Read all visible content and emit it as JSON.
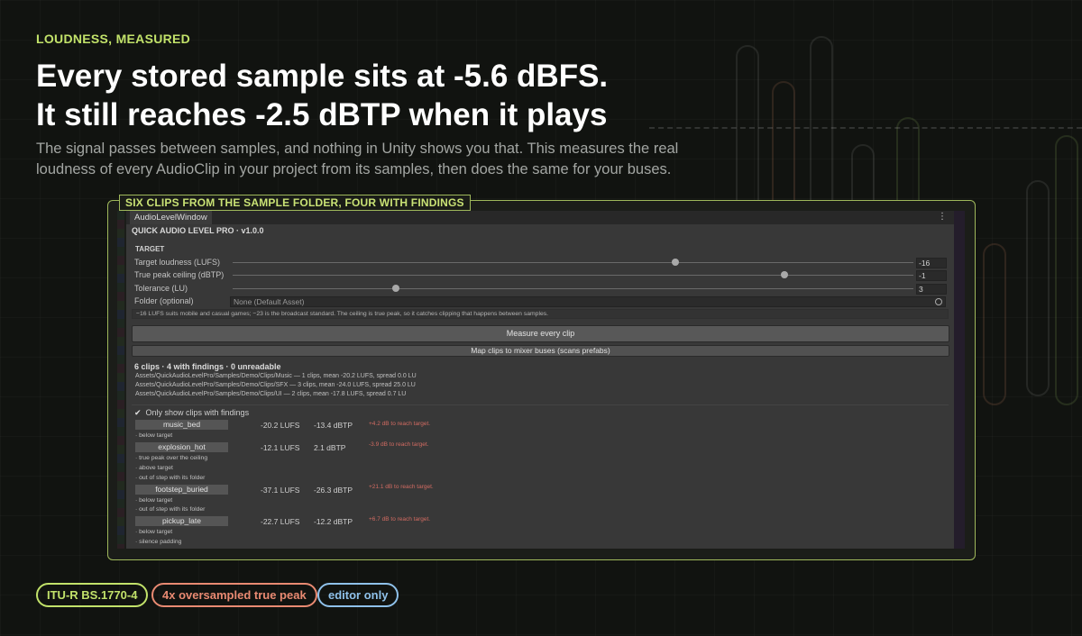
{
  "eyebrow": "LOUDNESS, MEASURED",
  "headline": {
    "line1": "Every stored sample sits at -5.6 dBFS.",
    "line2": "It still reaches -2.5 dBTP when it plays"
  },
  "subhead": "The signal passes between samples, and nothing in Unity shows you that. This measures the real loudness of every AudioClip in your project from its samples, then does the same for your buses.",
  "frame_label": "SIX CLIPS FROM THE SAMPLE FOLDER, FOUR WITH FINDINGS",
  "window": {
    "tab": "AudioLevelWindow",
    "menu_icon": "kebab-menu-icon",
    "app_title": "QUICK AUDIO LEVEL PRO · v1.0.0",
    "section": "TARGET",
    "fields": {
      "target_loudness": {
        "label": "Target loudness (LUFS)",
        "value": "-16",
        "level": 0.65
      },
      "true_peak": {
        "label": "True peak ceiling (dBTP)",
        "value": "-1",
        "level": 0.81
      },
      "tolerance": {
        "label": "Tolerance (LU)",
        "value": "3",
        "level": 0.24
      },
      "folder": {
        "label": "Folder (optional)",
        "value": "None (Default Asset)"
      }
    },
    "hint": "−16 LUFS suits mobile and casual games; −23 is the broadcast standard. The ceiling is true peak, so it catches clipping that happens between samples.",
    "measure_button": "Measure every clip",
    "map_button": "Map clips to mixer buses (scans prefabs)",
    "summary": "6 clips · 4 with findings · 0 unreadable",
    "folders": [
      "Assets/QuickAudioLevelPro/Samples/Demo/Clips/Music — 1 clips, mean -20.2 LUFS, spread 0.0 LU",
      "Assets/QuickAudioLevelPro/Samples/Demo/Clips/SFX — 3 clips, mean -24.0 LUFS, spread 25.0 LU",
      "Assets/QuickAudioLevelPro/Samples/Demo/Clips/UI — 2 clips, mean -17.8 LUFS, spread 0.7 LU"
    ],
    "only_show": "Only show clips with findings",
    "clips": [
      {
        "name": "music_bed",
        "lufs": "-20.2 LUFS",
        "tp": "-13.4 dBTP",
        "advice": "+4.2 dB to reach target.",
        "findings": [
          "· below target"
        ]
      },
      {
        "name": "explosion_hot",
        "lufs": "-12.1 LUFS",
        "tp": "2.1 dBTP",
        "advice": "-3.9 dB to reach target.",
        "findings": [
          "· true peak over the ceiling",
          "· above target",
          "· out of step with its folder"
        ]
      },
      {
        "name": "footstep_buried",
        "lufs": "-37.1 LUFS",
        "tp": "-26.3 dBTP",
        "advice": "+21.1 dB to reach target.",
        "findings": [
          "· below target",
          "· out of step with its folder"
        ]
      },
      {
        "name": "pickup_late",
        "lufs": "-22.7 LUFS",
        "tp": "-12.2 dBTP",
        "advice": "+6.7 dB to reach target.",
        "findings": [
          "· below target",
          "· silence padding"
        ]
      }
    ]
  },
  "badges": [
    {
      "label": "ITU-R BS.1770-4",
      "color": "#c2e26a"
    },
    {
      "label": "4x oversampled true peak",
      "color": "#e98a72"
    },
    {
      "label": "editor only",
      "color": "#8fc1ea"
    }
  ]
}
